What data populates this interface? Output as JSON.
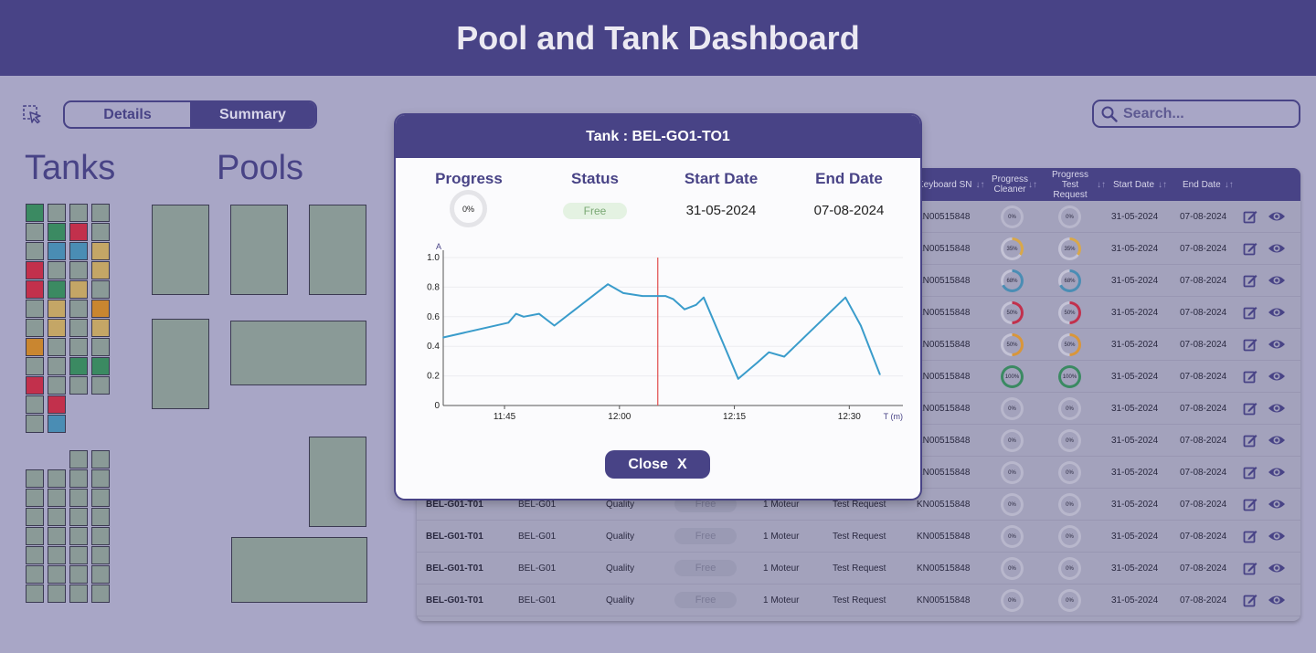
{
  "header": {
    "title": "Pool and Tank Dashboard"
  },
  "toolbar": {
    "details_label": "Details",
    "summary_label": "Summary"
  },
  "sections": {
    "tanks": "Tanks",
    "pools": "Pools"
  },
  "search": {
    "placeholder": "Search..."
  },
  "colors": {
    "primary": "#484386",
    "gray": "#8a9a97",
    "green": "#3b8a62",
    "red": "#c2304c",
    "blue": "#4a8db4",
    "tan": "#c4a666",
    "orange": "#c98630",
    "chart_line": "#3a9ccb",
    "marker": "#e35a5a"
  },
  "tank_grid": [
    [
      "green",
      "gray",
      "gray",
      "gray"
    ],
    [
      "gray",
      "green",
      "red",
      "gray"
    ],
    [
      "gray",
      "blue",
      "blue",
      "tan"
    ],
    [
      "red",
      "gray",
      "gray",
      "tan"
    ],
    [
      "red",
      "green",
      "tan",
      "gray"
    ],
    [
      "gray",
      "tan",
      "gray",
      "orange"
    ],
    [
      "gray",
      "tan",
      "gray",
      "tan"
    ],
    [
      "orange",
      "gray",
      "gray",
      "gray"
    ],
    [
      "gray",
      "gray",
      "green",
      "green"
    ],
    [
      "red",
      "gray",
      "gray",
      "gray"
    ],
    [
      "gray",
      "red",
      null,
      null
    ],
    [
      "gray",
      "blue",
      null,
      null
    ]
  ],
  "tank_grid2": [
    [
      null,
      null,
      "gray",
      "gray"
    ],
    [
      "gray",
      "gray",
      "gray",
      "gray"
    ],
    [
      "gray",
      "gray",
      "gray",
      "gray"
    ],
    [
      "gray",
      "gray",
      "gray",
      "gray"
    ],
    [
      "gray",
      "gray",
      "gray",
      "gray"
    ],
    [
      "gray",
      "gray",
      "gray",
      "gray"
    ],
    [
      "gray",
      "gray",
      "gray",
      "gray"
    ],
    [
      "gray",
      "gray",
      "gray",
      "gray"
    ]
  ],
  "table": {
    "headers": {
      "keyboard_sn": "Keyboard SN",
      "progress_cleaner": "Progress Cleaner",
      "progress_test": "Progress Test Request",
      "start_date": "Start Date",
      "end_date": "End Date"
    },
    "sort_icon": "sort-arrows-icon",
    "rows": [
      {
        "tank": "",
        "pool": "",
        "type": "",
        "status": "",
        "motor": "",
        "request": "",
        "sn": "KN00515848",
        "p1": 0,
        "p1_label": "0%",
        "p2": 0,
        "p2_label": "0%",
        "p_color": "#8a8aa6",
        "start": "31-05-2024",
        "end": "07-08-2024"
      },
      {
        "tank": "",
        "pool": "",
        "type": "",
        "status": "",
        "motor": "",
        "request": "",
        "sn": "KN00515848",
        "p1": 35,
        "p1_label": "35%",
        "p2": 35,
        "p2_label": "35%",
        "p_color": "#d9a84a",
        "start": "31-05-2024",
        "end": "07-08-2024"
      },
      {
        "tank": "",
        "pool": "",
        "type": "",
        "status": "",
        "motor": "",
        "request": "",
        "sn": "KN00515848",
        "p1": 68,
        "p1_label": "68%",
        "p2": 68,
        "p2_label": "68%",
        "p_color": "#4a8db4",
        "start": "31-05-2024",
        "end": "07-08-2024"
      },
      {
        "tank": "",
        "pool": "",
        "type": "",
        "status": "",
        "motor": "",
        "request": "",
        "sn": "KN00515848",
        "p1": 50,
        "p1_label": "50%",
        "p2": 50,
        "p2_label": "50%",
        "p_color": "#c2304c",
        "start": "31-05-2024",
        "end": "07-08-2024"
      },
      {
        "tank": "",
        "pool": "",
        "type": "",
        "status": "",
        "motor": "",
        "request": "",
        "sn": "KN00515848",
        "p1": 50,
        "p1_label": "50%",
        "p2": 50,
        "p2_label": "50%",
        "p_color": "#d9963a",
        "start": "31-05-2024",
        "end": "07-08-2024"
      },
      {
        "tank": "",
        "pool": "",
        "type": "",
        "status": "",
        "motor": "",
        "request": "",
        "sn": "KN00515848",
        "p1": 100,
        "p1_label": "100%",
        "p2": 100,
        "p2_label": "100%",
        "p_color": "#3b8a62",
        "start": "31-05-2024",
        "end": "07-08-2024"
      },
      {
        "tank": "",
        "pool": "",
        "type": "",
        "status": "",
        "motor": "",
        "request": "",
        "sn": "KN00515848",
        "p1": 0,
        "p1_label": "0%",
        "p2": 0,
        "p2_label": "0%",
        "p_color": "#8a8aa6",
        "start": "31-05-2024",
        "end": "07-08-2024"
      },
      {
        "tank": "",
        "pool": "",
        "type": "",
        "status": "",
        "motor": "",
        "request": "",
        "sn": "KN00515848",
        "p1": 0,
        "p1_label": "0%",
        "p2": 0,
        "p2_label": "0%",
        "p_color": "#8a8aa6",
        "start": "31-05-2024",
        "end": "07-08-2024"
      },
      {
        "tank": "",
        "pool": "",
        "type": "",
        "status": "",
        "motor": "",
        "request": "",
        "sn": "KN00515848",
        "p1": 0,
        "p1_label": "0%",
        "p2": 0,
        "p2_label": "0%",
        "p_color": "#8a8aa6",
        "start": "31-05-2024",
        "end": "07-08-2024"
      },
      {
        "tank": "BEL-G01-T01",
        "pool": "BEL-G01",
        "type": "Quality",
        "status": "Free",
        "motor": "1 Moteur",
        "request": "Test Request",
        "sn": "KN00515848",
        "p1": 0,
        "p1_label": "0%",
        "p2": 0,
        "p2_label": "0%",
        "p_color": "#8a8aa6",
        "start": "31-05-2024",
        "end": "07-08-2024"
      },
      {
        "tank": "BEL-G01-T01",
        "pool": "BEL-G01",
        "type": "Quality",
        "status": "Free",
        "motor": "1 Moteur",
        "request": "Test Request",
        "sn": "KN00515848",
        "p1": 0,
        "p1_label": "0%",
        "p2": 0,
        "p2_label": "0%",
        "p_color": "#8a8aa6",
        "start": "31-05-2024",
        "end": "07-08-2024"
      },
      {
        "tank": "BEL-G01-T01",
        "pool": "BEL-G01",
        "type": "Quality",
        "status": "Free",
        "motor": "1 Moteur",
        "request": "Test Request",
        "sn": "KN00515848",
        "p1": 0,
        "p1_label": "0%",
        "p2": 0,
        "p2_label": "0%",
        "p_color": "#8a8aa6",
        "start": "31-05-2024",
        "end": "07-08-2024"
      },
      {
        "tank": "BEL-G01-T01",
        "pool": "BEL-G01",
        "type": "Quality",
        "status": "Free",
        "motor": "1 Moteur",
        "request": "Test Request",
        "sn": "KN00515848",
        "p1": 0,
        "p1_label": "0%",
        "p2": 0,
        "p2_label": "0%",
        "p_color": "#8a8aa6",
        "start": "31-05-2024",
        "end": "07-08-2024"
      }
    ]
  },
  "modal": {
    "title": "Tank : BEL-GO1-TO1",
    "progress_label": "Progress",
    "progress_value": "0%",
    "progress_fraction": 0,
    "status_label": "Status",
    "status_value": "Free",
    "start_label": "Start Date",
    "start_value": "31-05-2024",
    "end_label": "End Date",
    "end_value": "07-08-2024",
    "close_label": "Close",
    "close_icon_text": "X"
  },
  "chart_data": {
    "type": "line",
    "ylabel": "A",
    "xlabel": "T (m)",
    "ylim": [
      0,
      1.0
    ],
    "xlim": [
      "11:37",
      "12:37"
    ],
    "yticks": [
      {
        "v": 0,
        "label": "0"
      },
      {
        "v": 0.2,
        "label": "0.2"
      },
      {
        "v": 0.4,
        "label": "0.4"
      },
      {
        "v": 0.6,
        "label": "0.6"
      },
      {
        "v": 0.8,
        "label": "0.8"
      },
      {
        "v": 1.0,
        "label": "1.0"
      }
    ],
    "xticks": [
      {
        "t": "11:45",
        "label": "11:45"
      },
      {
        "t": "12:00",
        "label": "12:00"
      },
      {
        "t": "12:15",
        "label": "12:15"
      },
      {
        "t": "12:30",
        "label": "12:30"
      }
    ],
    "grid": true,
    "marker_time": "12:05",
    "points": [
      [
        "11:37:00",
        0.46
      ],
      [
        "11:45:30",
        0.56
      ],
      [
        "11:46:30",
        0.62
      ],
      [
        "11:47:30",
        0.6
      ],
      [
        "11:49:30",
        0.62
      ],
      [
        "11:51:30",
        0.54
      ],
      [
        "11:54:00",
        0.64
      ],
      [
        "11:56:30",
        0.74
      ],
      [
        "11:58:30",
        0.82
      ],
      [
        "12:00:30",
        0.76
      ],
      [
        "12:03:00",
        0.74
      ],
      [
        "12:06:00",
        0.74
      ],
      [
        "12:07:00",
        0.72
      ],
      [
        "12:08:30",
        0.65
      ],
      [
        "12:10:00",
        0.68
      ],
      [
        "12:11:00",
        0.73
      ],
      [
        "12:15:30",
        0.18
      ],
      [
        "12:18:00",
        0.29
      ],
      [
        "12:19:30",
        0.36
      ],
      [
        "12:21:30",
        0.33
      ],
      [
        "12:29:30",
        0.73
      ],
      [
        "12:31:30",
        0.54
      ],
      [
        "12:34:00",
        0.21
      ]
    ]
  }
}
